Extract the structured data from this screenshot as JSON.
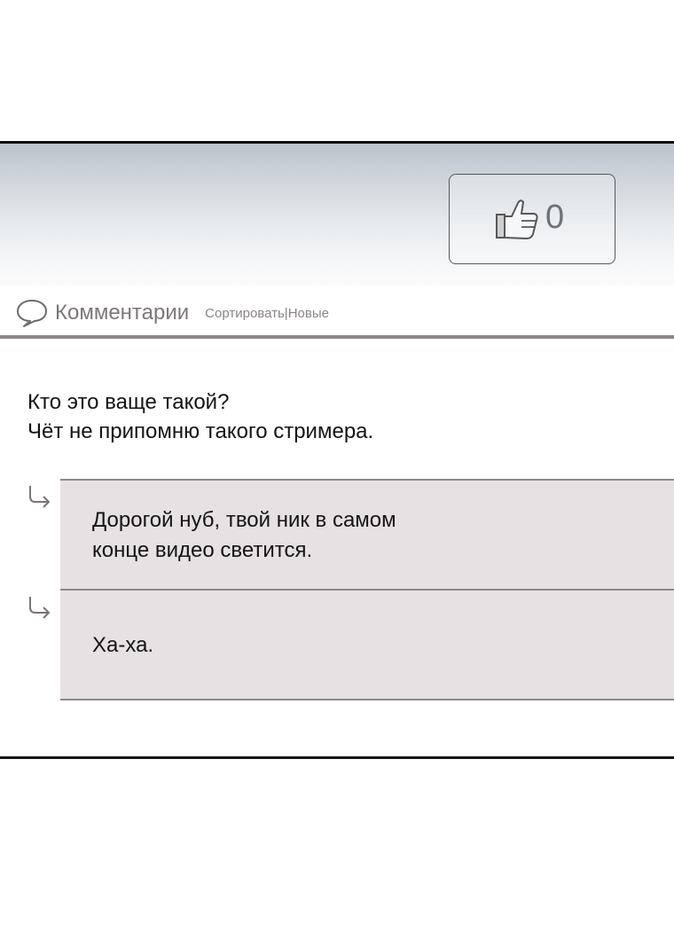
{
  "like": {
    "icon": "thumbs-up-icon",
    "count": "0"
  },
  "comments": {
    "icon": "comment-bubble-icon",
    "title": "Комментарии",
    "sort_label": "Сортировать|Новые"
  },
  "main_comment": {
    "line1": "Кто это ваще такой?",
    "line2": "Чёт не припомню такого стримера."
  },
  "replies": [
    {
      "icon": "reply-arrow-icon",
      "line1": "Дорогой нуб, твой ник в самом",
      "line2": "конце видео светится."
    },
    {
      "icon": "reply-arrow-icon",
      "line1": "Ха-ха."
    }
  ],
  "colors": {
    "divider": "#8e8688",
    "reply_background": "#e6e1e2",
    "text": "#141414",
    "muted_text": "#7d7779"
  }
}
